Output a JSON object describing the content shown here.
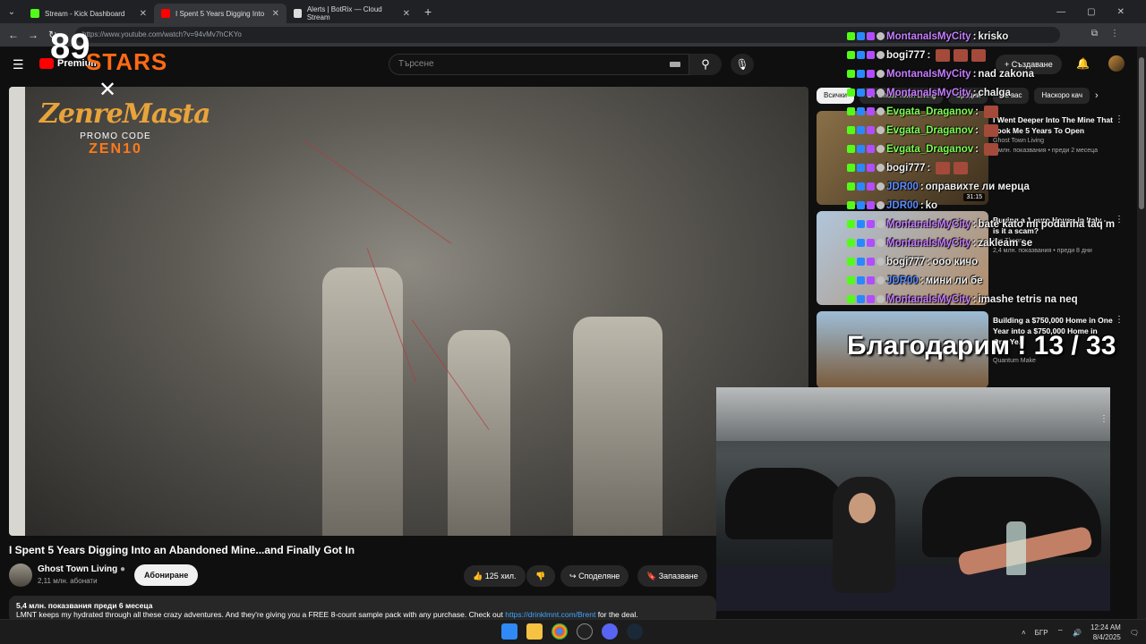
{
  "browser": {
    "tabs": [
      {
        "title": "Stream - Kick Dashboard",
        "color": "#53fc18",
        "active": false
      },
      {
        "title": "I Spent 5 Years Digging Into",
        "color": "#ff0000",
        "active": true
      },
      {
        "title": "Alerts | BotRix — Cloud Stream",
        "color": "#dddddd",
        "active": false
      }
    ],
    "url": "https://www.youtube.com/watch?v=94vMv7hCKYo"
  },
  "yt": {
    "logo_text": "Premium",
    "search_placeholder": "Търсене",
    "create_label": "Създаване",
    "chips": [
      "Всички",
      "От Ghost Town Living",
      "Сродни",
      "За вас",
      "Наскоро кач"
    ]
  },
  "overlay": {
    "stars_num": "89",
    "stars_text": "STARS",
    "promo_brand": "ZenreMasta",
    "promo_label": "PROMO CODE",
    "promo_code": "ZEN10"
  },
  "video": {
    "title": "I Spent 5 Years Digging Into an Abandoned Mine...and Finally Got In",
    "channel": "Ghost Town Living",
    "subs": "2,11 млн. абонати",
    "subscribe": "Абониране",
    "likes": "125 хил.",
    "share": "Споделяне",
    "save": "Запазване",
    "views_line": "5,4 млн. показвания  преди 6 месеца",
    "desc_prefix": "LMNT keeps my hydrated through all these crazy adventures. And they're giving you a FREE 8-count sample pack with any purchase. Check out ",
    "desc_link": "https://drinklmnt.com/Brent",
    "desc_suffix": " for the deal."
  },
  "recommendations": [
    {
      "title": "I Went Deeper Into The Mine That Took Me 5 Years To Open",
      "channel": "Ghost Town Living",
      "views": "2 млн. показвания • преди 2 месеца",
      "duration": "31:15",
      "color": "#6b5a3a"
    },
    {
      "title": "Buying a 1 euro House in Italy - is it a scam?",
      "channel": "Yes Theory",
      "views": "2,4 млн. показвания • преди 8 дни",
      "duration": "",
      "color": "#7a6a5a"
    },
    {
      "title": "Building a $750,000 Home in One Year into a $750,000 Home in One Ye...",
      "channel": "Quantum Make",
      "views": "",
      "duration": "",
      "color": "#8a6a4a"
    }
  ],
  "chat": [
    {
      "user": "MontanaIsMyCity",
      "color": "purple",
      "text": "krisko",
      "emotes": 0
    },
    {
      "user": "bogi777",
      "color": "white",
      "text": "",
      "emotes": 3
    },
    {
      "user": "MontanaIsMyCity",
      "color": "purple",
      "text": "nad zakona",
      "emotes": 0
    },
    {
      "user": "MontanaIsMyCity",
      "color": "purple",
      "text": "chalga",
      "emotes": 0
    },
    {
      "user": "Evgata_Draganov",
      "color": "green",
      "text": "",
      "emotes": 1
    },
    {
      "user": "Evgata_Draganov",
      "color": "green",
      "text": "",
      "emotes": 1
    },
    {
      "user": "Evgata_Draganov",
      "color": "green",
      "text": "",
      "emotes": 1
    },
    {
      "user": "bogi777",
      "color": "white",
      "text": "",
      "emotes": 2
    },
    {
      "user": "JDR00",
      "color": "blue",
      "text": "оправихте ли мерца",
      "emotes": 0
    },
    {
      "user": "JDR00",
      "color": "blue",
      "text": "ko",
      "emotes": 0
    },
    {
      "user": "MontanaIsMyCity",
      "color": "purple",
      "text": "bate kato mi podariha taq m",
      "emotes": 0
    },
    {
      "user": "MontanaIsMyCity",
      "color": "purple",
      "text": "zakleam se",
      "emotes": 0
    },
    {
      "user": "bogi777",
      "color": "white",
      "text": "ooo кичо",
      "emotes": 0
    },
    {
      "user": "JDR00",
      "color": "blue",
      "text": "мини ли бе",
      "emotes": 0
    },
    {
      "user": "MontanaIsMyCity",
      "color": "purple",
      "text": "imashe tetris na neq",
      "emotes": 0
    }
  ],
  "thanks_text": "Благодарим ! 13 / 33",
  "taskbar": {
    "lang": "БГР",
    "time": "12:24 AM",
    "date": "8/4/2025"
  }
}
